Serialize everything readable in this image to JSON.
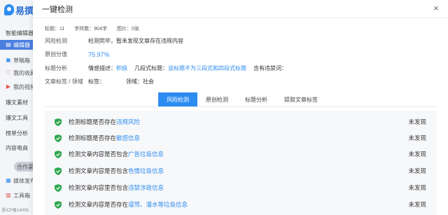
{
  "background": {
    "logo_text": "易撰",
    "sidebar": [
      {
        "label": "智能编辑器",
        "type": "section"
      },
      {
        "label": "编辑器",
        "type": "active",
        "icon": "edit-icon"
      },
      {
        "label": "草稿箱",
        "type": "item",
        "icon": "draft-icon"
      },
      {
        "label": "我的收藏",
        "type": "item",
        "icon": "heart-icon"
      },
      {
        "label": "我的视频",
        "type": "item",
        "icon": "video-icon"
      },
      {
        "label": "爆文素材",
        "type": "section"
      },
      {
        "label": "爆文工具",
        "type": "section"
      },
      {
        "label": "榜单分析",
        "type": "section"
      },
      {
        "label": "内容电商",
        "type": "section"
      },
      {
        "label": "合作渠道",
        "type": "pill"
      },
      {
        "label": "媒体发布",
        "type": "item",
        "icon": "media-icon"
      },
      {
        "label": "工具箱",
        "type": "item",
        "icon": "tool-icon"
      }
    ],
    "footer": "浙ICP备14006"
  },
  "modal": {
    "title": "一键检测",
    "close": "×",
    "stats": {
      "title_count": "标题：11",
      "char_count": "字符数：904字",
      "image_count": "图片：0张"
    },
    "risk": {
      "label": "风险检测",
      "value": "检测完毕，暂未发现文章存在违规内容"
    },
    "originality": {
      "label": "原创分值",
      "value": "75.97%"
    },
    "title_analysis": {
      "label": "标题分析",
      "emotion_label": "情感描述：",
      "emotion_value": "积极",
      "clause_label": "几段式标题：",
      "clause_value": "该标题不为三段式和四段式标题",
      "banned_label": "含有违禁词："
    },
    "article_tags": {
      "label": "文章标签 / 领域",
      "tags_label": "标签：",
      "domain_label": "领域：",
      "domain_value": "社会"
    },
    "tabs": [
      "风险检测",
      "原创检测",
      "标题分析",
      "提取文章标签"
    ],
    "active_tab": 0,
    "checks": [
      {
        "prefix": "检测标题是否存在",
        "link": "违规风险",
        "result": "未发现"
      },
      {
        "prefix": "检测标题是否存在",
        "link": "敏感信息",
        "result": "未发现"
      },
      {
        "prefix": "检测文章内容是否包含",
        "link": "广告垃圾信息",
        "result": "未发现"
      },
      {
        "prefix": "检测文章内容是否包含",
        "link": "色情垃圾信息",
        "result": "未发现"
      },
      {
        "prefix": "检测文章内容里否包含",
        "link": "违禁涉政信息",
        "result": "未发现"
      },
      {
        "prefix": "检测文章内容是否存在",
        "link": "谩骂、灌水等垃圾信息",
        "result": "未发现"
      }
    ],
    "colors": {
      "accent": "#2d8cf0",
      "pass": "#2fa84f"
    }
  }
}
